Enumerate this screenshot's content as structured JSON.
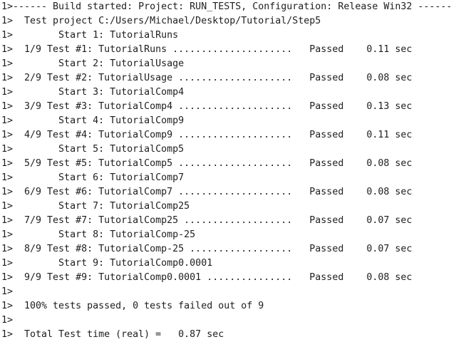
{
  "output": {
    "lines": [
      "1>------ Build started: Project: RUN_TESTS, Configuration: Release Win32 ------",
      "1>  Test project C:/Users/Michael/Desktop/Tutorial/Step5",
      "1>        Start 1: TutorialRuns",
      "1>  1/9 Test #1: TutorialRuns .....................   Passed    0.11 sec",
      "1>        Start 2: TutorialUsage",
      "1>  2/9 Test #2: TutorialUsage ....................   Passed    0.08 sec",
      "1>        Start 3: TutorialComp4",
      "1>  3/9 Test #3: TutorialComp4 ....................   Passed    0.13 sec",
      "1>        Start 4: TutorialComp9",
      "1>  4/9 Test #4: TutorialComp9 ....................   Passed    0.11 sec",
      "1>        Start 5: TutorialComp5",
      "1>  5/9 Test #5: TutorialComp5 ....................   Passed    0.08 sec",
      "1>        Start 6: TutorialComp7",
      "1>  6/9 Test #6: TutorialComp7 ....................   Passed    0.08 sec",
      "1>        Start 7: TutorialComp25",
      "1>  7/9 Test #7: TutorialComp25 ...................   Passed    0.07 sec",
      "1>        Start 8: TutorialComp-25",
      "1>  8/9 Test #8: TutorialComp-25 ..................   Passed    0.07 sec",
      "1>        Start 9: TutorialComp0.0001",
      "1>  9/9 Test #9: TutorialComp0.0001 ...............   Passed    0.08 sec",
      "1>",
      "1>  100% tests passed, 0 tests failed out of 9",
      "1>",
      "1>  Total Test time (real) =   0.87 sec"
    ]
  }
}
